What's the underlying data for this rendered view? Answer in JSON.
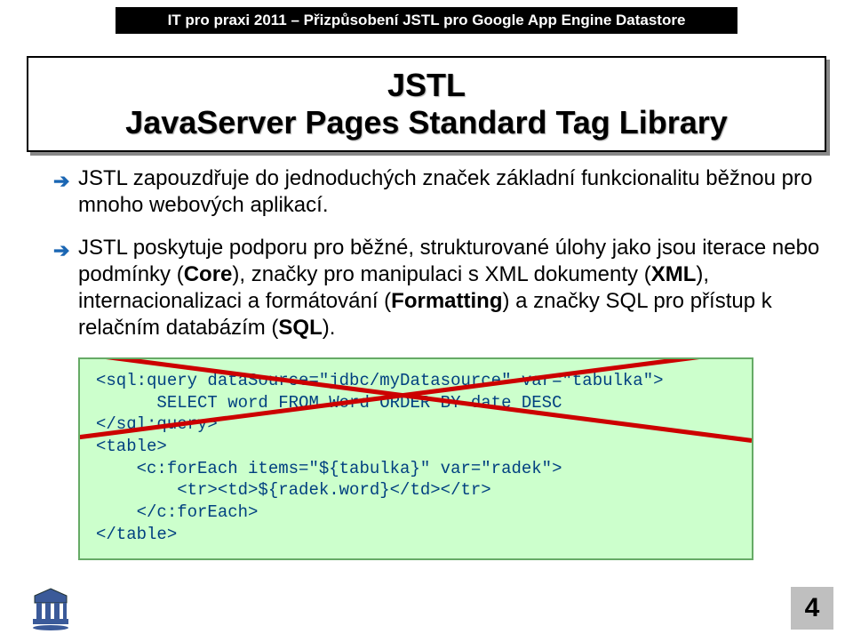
{
  "header": "IT pro praxi 2011 – Přizpůsobení JSTL pro Google App Engine Datastore",
  "title": {
    "line1": "JSTL",
    "line2": "JavaServer Pages Standard Tag Library"
  },
  "bullets": {
    "b1_pre": "JSTL zapouzdřuje do jednoduchých značek základní funkcionalitu běžnou pro mnoho webových aplikací.",
    "b2_a": "JSTL poskytuje podporu pro běžné, strukturované úlohy jako jsou iterace nebo podmínky (",
    "b2_core": "Core",
    "b2_b": "), značky pro manipulaci s XML dokumenty (",
    "b2_xml": "XML",
    "b2_c": "), internacionalizaci a formátování (",
    "b2_fmt": "Formatting",
    "b2_d": ") a značky SQL pro přístup k relačním databázím (",
    "b2_sql": "SQL",
    "b2_e": ")."
  },
  "code": {
    "l1": "<sql:query dataSource=\"jdbc/myDatasource\" var=\"tabulka\">",
    "l2": "      SELECT word FROM Word ORDER BY date DESC",
    "l3": "</sql:query>",
    "l4": "<table>",
    "l5": "    <c:forEach items=\"${tabulka}\" var=\"radek\">",
    "l6": "        <tr><td>${radek.word}</td></tr>",
    "l7": "    </c:forEach>",
    "l8": "</table>"
  },
  "page_number": "4"
}
